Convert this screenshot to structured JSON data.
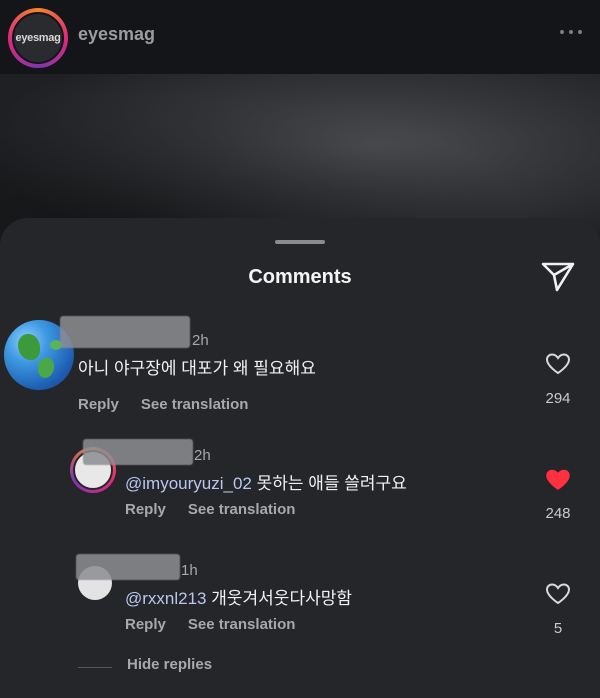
{
  "header": {
    "avatar_text": "eyesmag",
    "account_name": "eyesmag"
  },
  "sheet": {
    "title": "Comments"
  },
  "comments": [
    {
      "time": "2h",
      "mention": "",
      "text": "아니 야구장에 대포가 왜 필요해요",
      "reply_label": "Reply",
      "translate_label": "See translation",
      "likes": "294",
      "liked": false
    },
    {
      "time": "2h",
      "mention": "@imyouryuzi_02",
      "text": " 못하는 애들 쓸려구요",
      "reply_label": "Reply",
      "translate_label": "See translation",
      "likes": "248",
      "liked": true
    },
    {
      "time": "1h",
      "mention": "@rxxnl213",
      "text": " 개웃겨서웃다사망함",
      "reply_label": "Reply",
      "translate_label": "See translation",
      "likes": "5",
      "liked": false
    }
  ],
  "hide_replies_label": "Hide replies",
  "colors": {
    "liked_heart": "#ff3040",
    "mention": "#b9c7f0"
  }
}
